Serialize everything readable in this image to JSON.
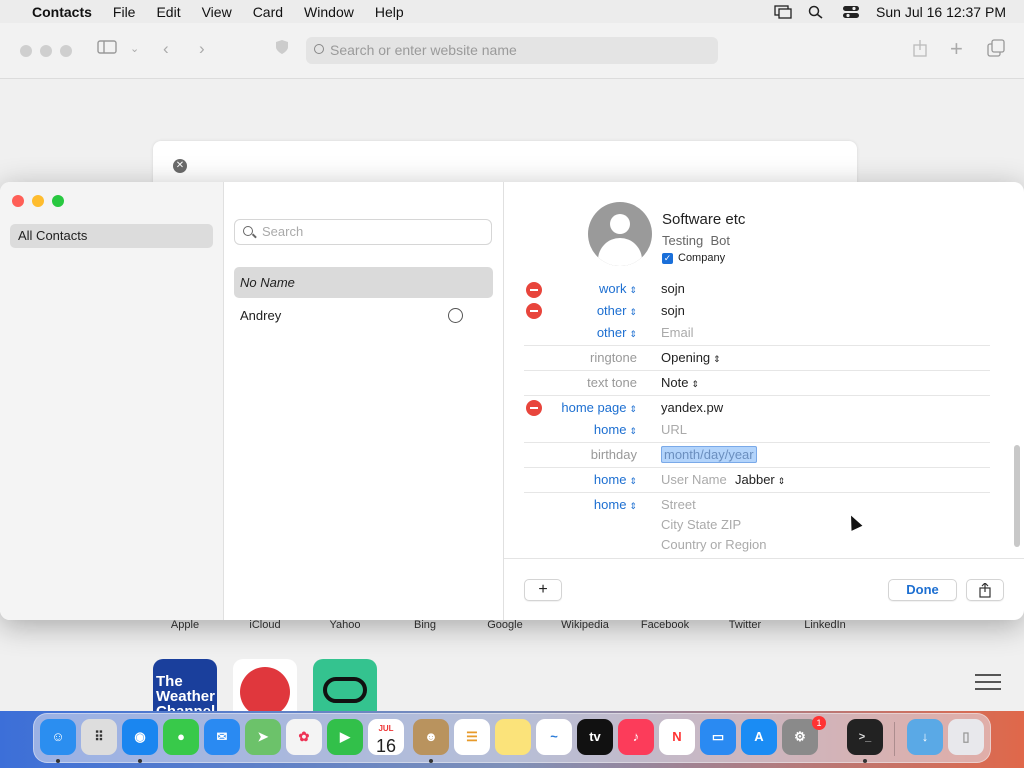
{
  "menubar": {
    "app": "Contacts",
    "items": [
      "File",
      "Edit",
      "View",
      "Card",
      "Window",
      "Help"
    ],
    "clock": "Sun Jul 16  12:37 PM"
  },
  "safari": {
    "url_placeholder": "Search or enter website name",
    "favorites": [
      "Apple",
      "iCloud",
      "Yahoo",
      "Bing",
      "Google",
      "Wikipedia",
      "Facebook",
      "Twitter",
      "LinkedIn"
    ],
    "tiles": [
      "The Weather Channel",
      "Yelp",
      "Tripadvisor"
    ]
  },
  "contacts": {
    "sidebar": {
      "all_contacts": "All Contacts"
    },
    "search_placeholder": "Search",
    "list": [
      {
        "name": "No Name"
      },
      {
        "name": "Andrey"
      }
    ],
    "card": {
      "name": "Software etc",
      "first": "Testing",
      "last": "Bot",
      "company_label": "Company",
      "fields": {
        "work_label": "work",
        "work_value": "sojn",
        "other1_label": "other",
        "other1_value": "sojn",
        "other2_label": "other",
        "other2_placeholder": "Email",
        "ringtone_label": "ringtone",
        "ringtone_value": "Opening",
        "texttone_label": "text tone",
        "texttone_value": "Note",
        "homepage_label": "home page",
        "homepage_value": "yandex.pw",
        "home_url_label": "home",
        "home_url_placeholder": "URL",
        "birthday_label": "birthday",
        "birthday_value": "month/day/year",
        "im_label": "home",
        "im_placeholder": "User Name",
        "im_service": "Jabber",
        "addr_label": "home",
        "addr_street": "Street",
        "addr_city": "City  State  ZIP",
        "addr_country": "Country or Region"
      }
    },
    "buttons": {
      "add": "+",
      "done": "Done",
      "share": "⇪"
    }
  },
  "dock": {
    "calendar_month": "JUL",
    "calendar_day": "16",
    "settings_badge": "1",
    "tv_label": "tv"
  },
  "colors": {
    "accent": "#1d6fd1",
    "remove": "#e8453c",
    "close": "#ff5f57",
    "minimize": "#febc2e",
    "zoom": "#28c840"
  }
}
